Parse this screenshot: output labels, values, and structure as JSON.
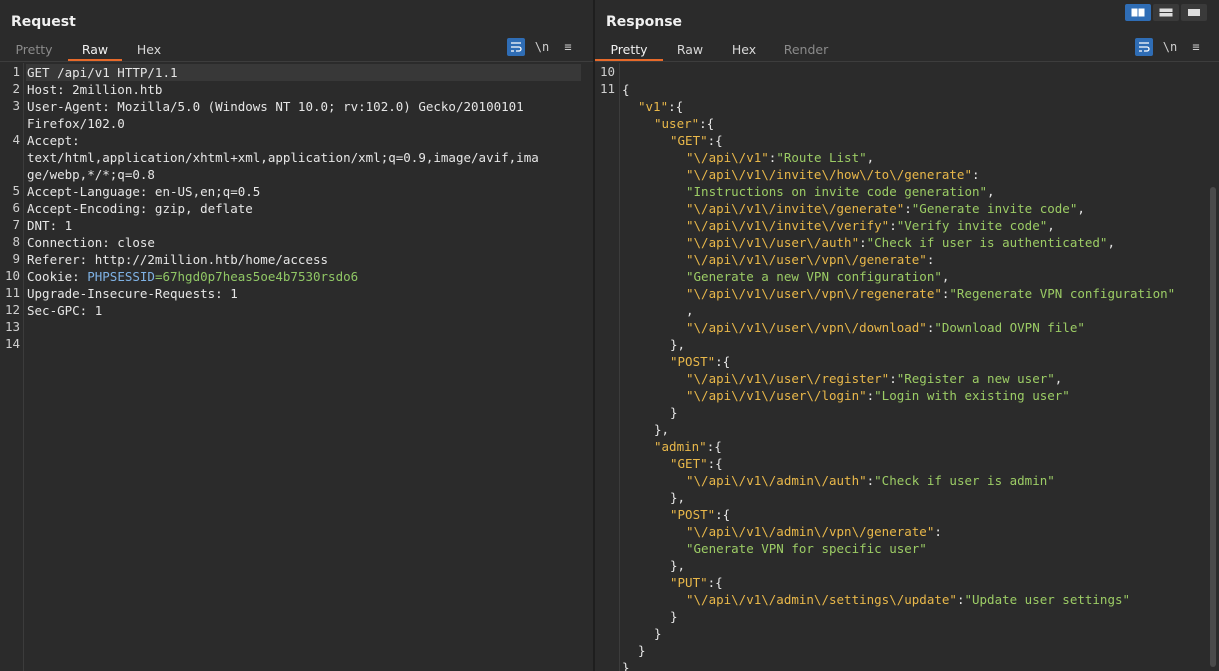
{
  "request": {
    "title": "Request",
    "tabs": [
      "Pretty",
      "Raw",
      "Hex"
    ],
    "active_tab": "Raw",
    "icons": [
      "wrap-lines-icon",
      "newline-icon",
      "menu-icon"
    ],
    "icon_glyphs": {
      "newline": "\\n",
      "menu": "≡"
    },
    "lines": [
      {
        "num": "1",
        "text": "GET /api/v1 HTTP/1.1"
      },
      {
        "num": "2",
        "text": "Host: 2million.htb"
      },
      {
        "num": "3",
        "text": "User-Agent: Mozilla/5.0 (Windows NT 10.0; rv:102.0) Gecko/20100101"
      },
      {
        "num": "",
        "text": "Firefox/102.0"
      },
      {
        "num": "4",
        "text": "Accept:"
      },
      {
        "num": "",
        "text": "text/html,application/xhtml+xml,application/xml;q=0.9,image/avif,ima"
      },
      {
        "num": "",
        "text": "ge/webp,*/*;q=0.8"
      },
      {
        "num": "5",
        "text": "Accept-Language: en-US,en;q=0.5"
      },
      {
        "num": "6",
        "text": "Accept-Encoding: gzip, deflate"
      },
      {
        "num": "7",
        "text": "DNT: 1"
      },
      {
        "num": "8",
        "text": "Connection: close"
      },
      {
        "num": "9",
        "text": "Referer: http://2million.htb/home/access"
      },
      {
        "num": "10",
        "text": "Cookie: ",
        "cookie_key": "PHPSESSID",
        "cookie_eq": "=",
        "cookie_val": "67hgd0p7heas5oe4b7530rsdo6"
      },
      {
        "num": "11",
        "text": "Upgrade-Insecure-Requests: 1"
      },
      {
        "num": "12",
        "text": "Sec-GPC: 1"
      },
      {
        "num": "13",
        "text": ""
      },
      {
        "num": "14",
        "text": ""
      }
    ]
  },
  "response": {
    "title": "Response",
    "tabs": [
      "Pretty",
      "Raw",
      "Hex",
      "Render"
    ],
    "active_tab": "Pretty",
    "layout_buttons": [
      "side-by-side",
      "stacked",
      "single"
    ],
    "line_numbers": [
      "10",
      "11"
    ],
    "lines": [
      {
        "indent": 0,
        "parts": [
          {
            "t": "{",
            "c": "p"
          }
        ]
      },
      {
        "indent": 1,
        "parts": [
          {
            "t": "\"v1\"",
            "c": "k"
          },
          {
            "t": ":{",
            "c": "p"
          }
        ]
      },
      {
        "indent": 2,
        "parts": [
          {
            "t": "\"user\"",
            "c": "k"
          },
          {
            "t": ":{",
            "c": "p"
          }
        ]
      },
      {
        "indent": 3,
        "parts": [
          {
            "t": "\"GET\"",
            "c": "k"
          },
          {
            "t": ":{",
            "c": "p"
          }
        ]
      },
      {
        "indent": 4,
        "parts": [
          {
            "t": "\"\\/api\\/v1\"",
            "c": "k"
          },
          {
            "t": ":",
            "c": "p"
          },
          {
            "t": "\"Route List\"",
            "c": "v"
          },
          {
            "t": ",",
            "c": "p"
          }
        ]
      },
      {
        "indent": 4,
        "parts": [
          {
            "t": "\"\\/api\\/v1\\/invite\\/how\\/to\\/generate\"",
            "c": "k"
          },
          {
            "t": ":",
            "c": "p"
          }
        ]
      },
      {
        "indent": 4,
        "parts": [
          {
            "t": "\"Instructions on invite code generation\"",
            "c": "v"
          },
          {
            "t": ",",
            "c": "p"
          }
        ]
      },
      {
        "indent": 4,
        "parts": [
          {
            "t": "\"\\/api\\/v1\\/invite\\/generate\"",
            "c": "k"
          },
          {
            "t": ":",
            "c": "p"
          },
          {
            "t": "\"Generate invite code\"",
            "c": "v"
          },
          {
            "t": ",",
            "c": "p"
          }
        ]
      },
      {
        "indent": 4,
        "parts": [
          {
            "t": "\"\\/api\\/v1\\/invite\\/verify\"",
            "c": "k"
          },
          {
            "t": ":",
            "c": "p"
          },
          {
            "t": "\"Verify invite code\"",
            "c": "v"
          },
          {
            "t": ",",
            "c": "p"
          }
        ]
      },
      {
        "indent": 4,
        "parts": [
          {
            "t": "\"\\/api\\/v1\\/user\\/auth\"",
            "c": "k"
          },
          {
            "t": ":",
            "c": "p"
          },
          {
            "t": "\"Check if user is authenticated\"",
            "c": "v"
          },
          {
            "t": ",",
            "c": "p"
          }
        ]
      },
      {
        "indent": 4,
        "parts": [
          {
            "t": "\"\\/api\\/v1\\/user\\/vpn\\/generate\"",
            "c": "k"
          },
          {
            "t": ":",
            "c": "p"
          }
        ]
      },
      {
        "indent": 4,
        "parts": [
          {
            "t": "\"Generate a new VPN configuration\"",
            "c": "v"
          },
          {
            "t": ",",
            "c": "p"
          }
        ]
      },
      {
        "indent": 4,
        "parts": [
          {
            "t": "\"\\/api\\/v1\\/user\\/vpn\\/regenerate\"",
            "c": "k"
          },
          {
            "t": ":",
            "c": "p"
          },
          {
            "t": "\"Regenerate VPN configuration\"",
            "c": "v"
          }
        ]
      },
      {
        "indent": 4,
        "parts": [
          {
            "t": ",",
            "c": "p"
          }
        ]
      },
      {
        "indent": 4,
        "parts": [
          {
            "t": "\"\\/api\\/v1\\/user\\/vpn\\/download\"",
            "c": "k"
          },
          {
            "t": ":",
            "c": "p"
          },
          {
            "t": "\"Download OVPN file\"",
            "c": "v"
          }
        ]
      },
      {
        "indent": 3,
        "parts": [
          {
            "t": "},",
            "c": "p"
          }
        ]
      },
      {
        "indent": 3,
        "parts": [
          {
            "t": "\"POST\"",
            "c": "k"
          },
          {
            "t": ":{",
            "c": "p"
          }
        ]
      },
      {
        "indent": 4,
        "parts": [
          {
            "t": "\"\\/api\\/v1\\/user\\/register\"",
            "c": "k"
          },
          {
            "t": ":",
            "c": "p"
          },
          {
            "t": "\"Register a new user\"",
            "c": "v"
          },
          {
            "t": ",",
            "c": "p"
          }
        ]
      },
      {
        "indent": 4,
        "parts": [
          {
            "t": "\"\\/api\\/v1\\/user\\/login\"",
            "c": "k"
          },
          {
            "t": ":",
            "c": "p"
          },
          {
            "t": "\"Login with existing user\"",
            "c": "v"
          }
        ]
      },
      {
        "indent": 3,
        "parts": [
          {
            "t": "}",
            "c": "p"
          }
        ]
      },
      {
        "indent": 2,
        "parts": [
          {
            "t": "},",
            "c": "p"
          }
        ]
      },
      {
        "indent": 2,
        "parts": [
          {
            "t": "\"admin\"",
            "c": "k"
          },
          {
            "t": ":{",
            "c": "p"
          }
        ]
      },
      {
        "indent": 3,
        "parts": [
          {
            "t": "\"GET\"",
            "c": "k"
          },
          {
            "t": ":{",
            "c": "p"
          }
        ]
      },
      {
        "indent": 4,
        "parts": [
          {
            "t": "\"\\/api\\/v1\\/admin\\/auth\"",
            "c": "k"
          },
          {
            "t": ":",
            "c": "p"
          },
          {
            "t": "\"Check if user is admin\"",
            "c": "v"
          }
        ]
      },
      {
        "indent": 3,
        "parts": [
          {
            "t": "},",
            "c": "p"
          }
        ]
      },
      {
        "indent": 3,
        "parts": [
          {
            "t": "\"POST\"",
            "c": "k"
          },
          {
            "t": ":{",
            "c": "p"
          }
        ]
      },
      {
        "indent": 4,
        "parts": [
          {
            "t": "\"\\/api\\/v1\\/admin\\/vpn\\/generate\"",
            "c": "k"
          },
          {
            "t": ":",
            "c": "p"
          }
        ]
      },
      {
        "indent": 4,
        "parts": [
          {
            "t": "\"Generate VPN for specific user\"",
            "c": "v"
          }
        ]
      },
      {
        "indent": 3,
        "parts": [
          {
            "t": "},",
            "c": "p"
          }
        ]
      },
      {
        "indent": 3,
        "parts": [
          {
            "t": "\"PUT\"",
            "c": "k"
          },
          {
            "t": ":{",
            "c": "p"
          }
        ]
      },
      {
        "indent": 4,
        "parts": [
          {
            "t": "\"\\/api\\/v1\\/admin\\/settings\\/update\"",
            "c": "k"
          },
          {
            "t": ":",
            "c": "p"
          },
          {
            "t": "\"Update user settings\"",
            "c": "v"
          }
        ]
      },
      {
        "indent": 3,
        "parts": [
          {
            "t": "}",
            "c": "p"
          }
        ]
      },
      {
        "indent": 2,
        "parts": [
          {
            "t": "}",
            "c": "p"
          }
        ]
      },
      {
        "indent": 1,
        "parts": [
          {
            "t": "}",
            "c": "p"
          }
        ]
      },
      {
        "indent": 0,
        "parts": [
          {
            "t": "}",
            "c": "p"
          }
        ]
      }
    ]
  },
  "colors": {
    "accent": "#e86a2a",
    "key": "#e9b84a",
    "value": "#9ccc65",
    "toggle": "#2f6db5"
  }
}
